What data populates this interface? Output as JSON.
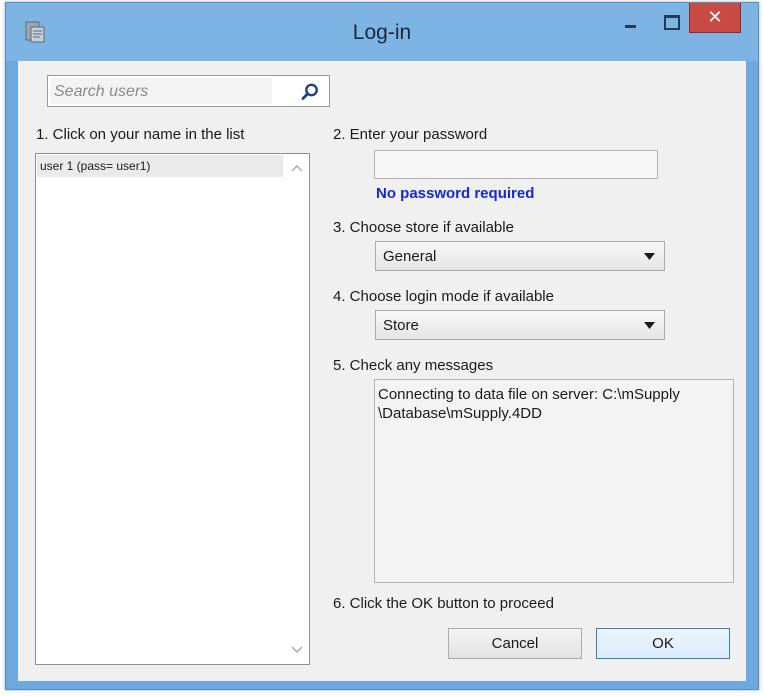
{
  "window": {
    "title": "Log-in",
    "close_glyph": "✕"
  },
  "search": {
    "placeholder": "Search users",
    "value": ""
  },
  "user_list": {
    "heading": "1. Click on your name in the list",
    "items": [
      "user 1 (pass= user1)"
    ]
  },
  "password": {
    "heading": "2. Enter your password",
    "value": "",
    "note": "No password required"
  },
  "store": {
    "heading": "3. Choose store if available",
    "selected": "General"
  },
  "login_mode": {
    "heading": "4. Choose login mode if available",
    "selected": "Store"
  },
  "messages": {
    "heading": "5. Check any messages",
    "lines": [
      "Connecting to data file on server: C:\\mSupply",
      "\\Database\\mSupply.4DD"
    ]
  },
  "proceed": {
    "heading": "6. Click the OK button to proceed"
  },
  "buttons": {
    "cancel": "Cancel",
    "ok": "OK"
  },
  "icons": {
    "app": "app-icon",
    "search": "search-icon",
    "minimize": "minimize-icon",
    "maximize": "maximize-icon",
    "close": "close-icon",
    "scroll_up": "chevron-up-icon",
    "scroll_down": "chevron-down-icon",
    "dropdown": "triangle-down-icon"
  },
  "colors": {
    "titlebar": "#7db4e4",
    "close_button": "#c94a43",
    "client_background": "#f0f0f0",
    "password_note": "#1428d6",
    "ok_button_border": "#3c7fb1"
  }
}
